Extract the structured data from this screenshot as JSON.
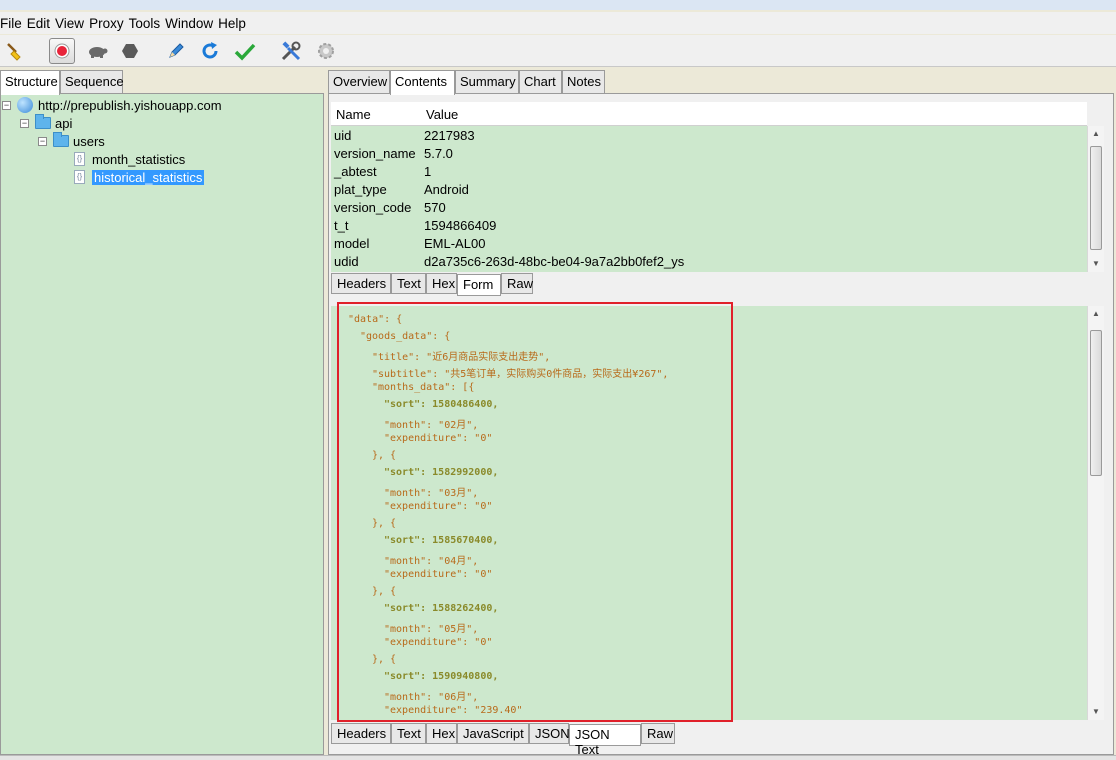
{
  "menu": [
    "File",
    "Edit",
    "View",
    "Proxy",
    "Tools",
    "Window",
    "Help"
  ],
  "toolbar_icons": [
    "broom-icon",
    "record-icon",
    "turtle-icon",
    "stop-hexagon-icon",
    "pen-icon",
    "refresh-icon",
    "check-icon",
    "tools-icon",
    "settings-gear-icon"
  ],
  "left_tabs": [
    "Structure",
    "Sequence"
  ],
  "tree": {
    "host": "http://prepublish.yishouapp.com",
    "folder1": "api",
    "folder2": "users",
    "file1": "month_statistics",
    "file2": "historical_statistics"
  },
  "right_tabs": [
    "Overview",
    "Contents",
    "Summary",
    "Chart",
    "Notes"
  ],
  "kv_headers": [
    "Name",
    "Value"
  ],
  "kv_rows": [
    [
      "uid",
      "2217983"
    ],
    [
      "version_name",
      "5.7.0"
    ],
    [
      "_abtest",
      "1"
    ],
    [
      "plat_type",
      "Android"
    ],
    [
      "version_code",
      "570"
    ],
    [
      "t_t",
      "1594866409"
    ],
    [
      "model",
      "EML-AL00"
    ],
    [
      "udid",
      "d2a735c6-263d-48bc-be04-9a7a2bb0fef2_ys"
    ]
  ],
  "request_tabs": [
    "Headers",
    "Text",
    "Hex",
    "Form",
    "Raw"
  ],
  "response_tabs": [
    "Headers",
    "Text",
    "Hex",
    "JavaScript",
    "JSON",
    "JSON Text",
    "Raw"
  ],
  "json_lines": [
    "\"data\": {",
    "\"goods_data\": {",
    "\"title\": \"近6月商品实际支出走势\",",
    "\"subtitle\": \"共5笔订单，实际购买0件商品，实际支出¥267\",",
    "\"months_data\": [{",
    "\"sort\": 1580486400,",
    "\"month\": \"02月\",",
    "\"expenditure\": \"0\"",
    "}, {",
    "\"sort\": 1582992000,",
    "\"month\": \"03月\",",
    "\"expenditure\": \"0\"",
    "}, {",
    "\"sort\": 1585670400,",
    "\"month\": \"04月\",",
    "\"expenditure\": \"0\"",
    "}, {",
    "\"sort\": 1588262400,",
    "\"month\": \"05月\",",
    "\"expenditure\": \"0\"",
    "}, {",
    "\"sort\": 1590940800,",
    "\"month\": \"06月\",",
    "\"expenditure\": \"239.40\""
  ],
  "colors": {
    "pane_bg": "#cde8cd",
    "selection": "#3399ff",
    "highlight_box": "#e0202a",
    "json_string": "#b86a1a",
    "json_number": "#8a8a2a"
  }
}
